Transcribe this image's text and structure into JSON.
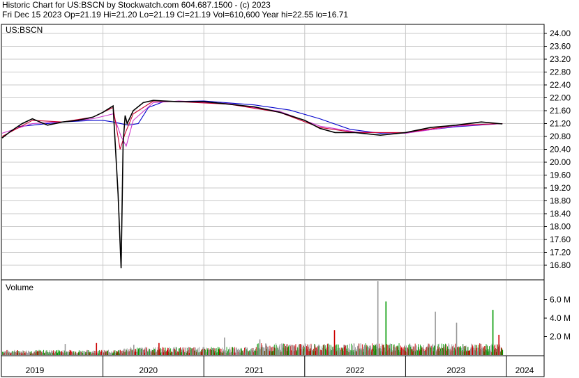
{
  "header": {
    "line1": "Historic Chart for US:BSCN by Stockwatch.com 604.687.1500 - (c) 2023",
    "line2": "Fri Dec 15 2023   Op=21.19   Hi=21.20   Lo=21.19   Cl=21.19   Vol=610,600   Year hi=22.55   lo=16.71"
  },
  "chart_data": [
    {
      "type": "line",
      "title": "US:BSCN",
      "ylabel": "",
      "ylim": [
        16.4,
        24.2
      ],
      "yticks": [
        "24.00",
        "23.60",
        "23.20",
        "22.80",
        "22.40",
        "22.00",
        "21.60",
        "21.20",
        "20.80",
        "20.40",
        "20.00",
        "19.60",
        "19.20",
        "18.80",
        "18.40",
        "18.00",
        "17.60",
        "17.20",
        "16.80"
      ],
      "grid": true,
      "colors": {
        "price": "#000000",
        "ma_short": "#cc0033",
        "ma_mid": "#cc33cc",
        "ma_long": "#0000cc"
      },
      "series": [
        {
          "key": "price",
          "x": [
            2019.0,
            2019.08,
            2019.2,
            2019.3,
            2019.45,
            2019.6,
            2019.75,
            2019.9,
            2020.0,
            2020.1,
            2020.15,
            2020.18,
            2020.2,
            2020.22,
            2020.24,
            2020.3,
            2020.4,
            2020.5,
            2020.6,
            2020.75,
            2021.0,
            2021.25,
            2021.5,
            2021.75,
            2022.0,
            2022.15,
            2022.3,
            2022.5,
            2022.75,
            2023.0,
            2023.25,
            2023.5,
            2023.75,
            2023.96
          ],
          "y": [
            20.75,
            20.95,
            21.2,
            21.35,
            21.15,
            21.25,
            21.3,
            21.4,
            21.55,
            21.75,
            19.0,
            16.71,
            20.6,
            21.45,
            21.2,
            21.6,
            21.85,
            21.92,
            21.9,
            21.88,
            21.88,
            21.8,
            21.72,
            21.55,
            21.3,
            21.05,
            20.92,
            20.92,
            20.84,
            20.92,
            21.08,
            21.15,
            21.25,
            21.19
          ]
        },
        {
          "key": "ma_short",
          "x": [
            2019.0,
            2019.3,
            2019.6,
            2019.9,
            2020.1,
            2020.17,
            2020.22,
            2020.3,
            2020.5,
            2020.75,
            2021.25,
            2021.75,
            2022.15,
            2022.5,
            2023.0,
            2023.5,
            2023.96
          ],
          "y": [
            20.8,
            21.3,
            21.25,
            21.4,
            21.7,
            20.4,
            20.9,
            21.5,
            21.9,
            21.88,
            21.8,
            21.55,
            21.08,
            20.92,
            20.92,
            21.15,
            21.2
          ]
        },
        {
          "key": "ma_mid",
          "x": [
            2019.0,
            2019.3,
            2019.6,
            2019.9,
            2020.1,
            2020.18,
            2020.23,
            2020.3,
            2020.5,
            2020.75,
            2021.25,
            2021.75,
            2022.15,
            2022.5,
            2023.0,
            2023.5,
            2023.96
          ],
          "y": [
            20.9,
            21.2,
            21.25,
            21.35,
            21.5,
            20.8,
            20.5,
            21.3,
            21.85,
            21.9,
            21.82,
            21.58,
            21.12,
            20.94,
            20.9,
            21.12,
            21.2
          ]
        },
        {
          "key": "ma_long",
          "x": [
            2019.15,
            2019.6,
            2019.9,
            2020.0,
            2020.1,
            2020.25,
            2020.35,
            2020.45,
            2020.6,
            2021.0,
            2021.5,
            2021.85,
            2022.15,
            2022.45,
            2022.75,
            2023.0,
            2023.5,
            2023.96
          ],
          "y": [
            21.1,
            21.25,
            21.3,
            21.3,
            21.25,
            21.15,
            21.2,
            21.7,
            21.88,
            21.9,
            21.78,
            21.62,
            21.35,
            21.02,
            20.9,
            20.92,
            21.1,
            21.2
          ]
        }
      ]
    },
    {
      "type": "bar",
      "title": "Volume",
      "ylim": [
        0,
        8.0
      ],
      "yticks": [
        "6.0 M",
        "4.0 M",
        "2.0 M"
      ],
      "unit": "M",
      "colors": {
        "up": "#009900",
        "down": "#cc0000",
        "flat": "#999999"
      },
      "spikes": [
        {
          "x": 2019.62,
          "v": 1.2,
          "c": "flat"
        },
        {
          "x": 2019.93,
          "v": 1.3,
          "c": "down"
        },
        {
          "x": 2020.3,
          "v": 1.1,
          "c": "flat"
        },
        {
          "x": 2020.55,
          "v": 1.3,
          "c": "down"
        },
        {
          "x": 2021.2,
          "v": 1.9,
          "c": "flat"
        },
        {
          "x": 2021.55,
          "v": 1.7,
          "c": "flat"
        },
        {
          "x": 2021.95,
          "v": 1.2,
          "c": "down"
        },
        {
          "x": 2022.29,
          "v": 2.7,
          "c": "down"
        },
        {
          "x": 2022.72,
          "v": 8.0,
          "c": "flat"
        },
        {
          "x": 2022.8,
          "v": 5.8,
          "c": "up"
        },
        {
          "x": 2023.29,
          "v": 4.7,
          "c": "flat"
        },
        {
          "x": 2023.5,
          "v": 3.5,
          "c": "flat"
        },
        {
          "x": 2023.86,
          "v": 4.9,
          "c": "up"
        },
        {
          "x": 2023.92,
          "v": 2.2,
          "c": "down"
        }
      ]
    }
  ],
  "xaxis": {
    "labels": [
      "2019",
      "2020",
      "2021",
      "2022",
      "2023",
      "2024"
    ]
  },
  "price_label": "US:BSCN",
  "volume_label": "Volume"
}
